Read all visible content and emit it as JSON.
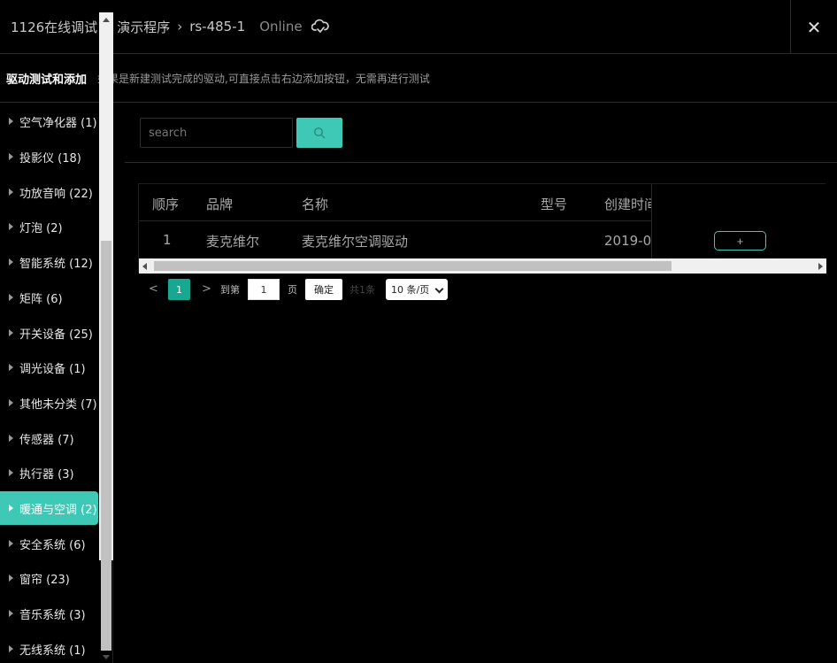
{
  "header": {
    "breadcrumb": [
      "1126在线调试",
      "演示程序",
      "rs-485-1"
    ],
    "status": "Online",
    "cloud_icon": "cloud-sync-icon",
    "close_icon": "close-icon",
    "close_symbol": "✕"
  },
  "subheader": {
    "title": "驱动测试和添加",
    "description": "如果是新建测试完成的驱动,可直接点击右边添加按钮，无需再进行测试"
  },
  "sidebar": {
    "items": [
      {
        "label": "空气净化器 (1)"
      },
      {
        "label": "投影仪 (18)"
      },
      {
        "label": "功放音响 (22)"
      },
      {
        "label": "灯泡 (2)"
      },
      {
        "label": "智能系统 (12)"
      },
      {
        "label": "矩阵 (6)"
      },
      {
        "label": "开关设备 (25)"
      },
      {
        "label": "调光设备 (1)"
      },
      {
        "label": "其他未分类 (7)"
      },
      {
        "label": "传感器 (7)"
      },
      {
        "label": "执行器 (3)"
      },
      {
        "label": "暖通与空调 (2)",
        "active": true
      },
      {
        "label": "安全系统 (6)"
      },
      {
        "label": "窗帘 (23)"
      },
      {
        "label": "音乐系统 (3)"
      },
      {
        "label": "无线系统 (1)"
      }
    ]
  },
  "search": {
    "placeholder": "search",
    "value": "",
    "button_icon": "search-icon"
  },
  "table": {
    "columns": [
      "顺序",
      "品牌",
      "名称",
      "型号",
      "创建时间"
    ],
    "rows": [
      {
        "index": "1",
        "brand": "麦克维尔",
        "name": "麦克维尔空调驱动",
        "model": "",
        "created": "2019-0"
      }
    ],
    "add_label": "+"
  },
  "pagination": {
    "prev": "<",
    "current": "1",
    "next": ">",
    "goto_label": "到第",
    "goto_value": "1",
    "page_unit": "页",
    "confirm_label": "确定",
    "total": "共1条",
    "page_size": "10 条/页"
  },
  "colors": {
    "accent": "#3ec9b6",
    "pager_active": "#18a892",
    "background": "#000000"
  }
}
